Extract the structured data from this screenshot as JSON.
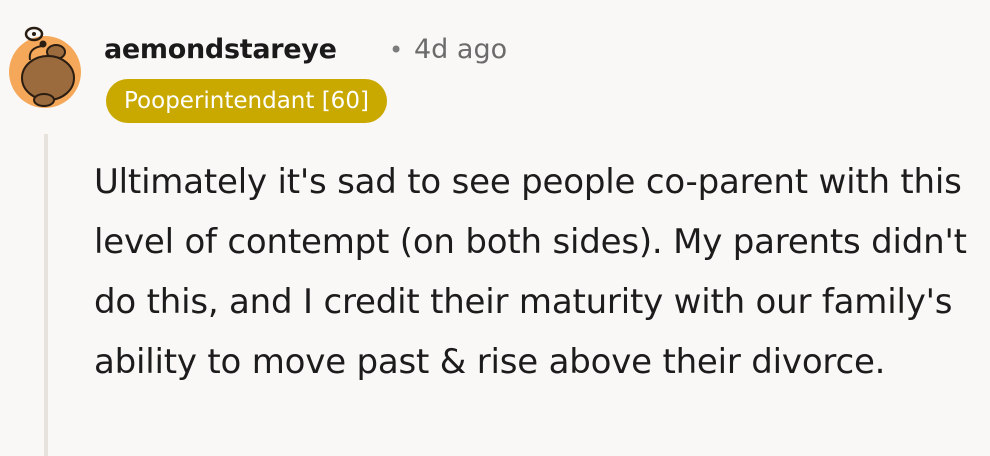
{
  "comment": {
    "author": "aemondstareye",
    "separator": "•",
    "timestamp": "4d ago",
    "flair": "Pooperintendant [60]",
    "body": "Ultimately it's sad to see people co-parent with this level of contempt (on both sides). My parents didn't do this, and I credit their maturity with our family's ability to move past & rise above their divorce."
  },
  "avatar": {
    "icon": "snoo-avatar-icon",
    "background_color": "#f5a85a",
    "head_color": "#9b6a3d"
  },
  "colors": {
    "flair_background": "#c9a800",
    "flair_text": "#ffffff",
    "thread_line": "#e8e2dc",
    "page_background": "#faf8f6"
  }
}
